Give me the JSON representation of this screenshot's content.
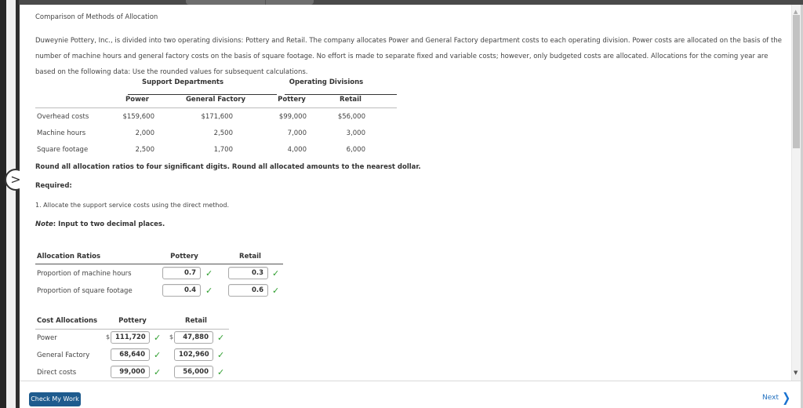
{
  "problem": {
    "title": "Comparison of Methods of Allocation",
    "paragraph": "Duweynie Pottery, Inc., is divided into two operating divisions: Pottery and Retail. The company allocates Power and General Factory department costs to each operating division. Power costs are allocated on the basis of the number of machine hours and general factory costs on the basis of square footage. No effort is made to separate fixed and variable costs; however, only budgeted costs are allocated. Allocations for the coming year are based on the following data: Use the rounded values for subsequent calculations."
  },
  "data_table": {
    "group_headers": [
      "Support Departments",
      "Operating Divisions"
    ],
    "columns": [
      "Power",
      "General Factory",
      "Pottery",
      "Retail"
    ],
    "rows": [
      {
        "label": "Overhead costs",
        "values": [
          "$159,600",
          "$171,600",
          "$99,000",
          "$56,000"
        ]
      },
      {
        "label": "Machine hours",
        "values": [
          "2,000",
          "2,500",
          "7,000",
          "3,000"
        ]
      },
      {
        "label": "Square footage",
        "values": [
          "2,500",
          "1,700",
          "4,000",
          "6,000"
        ]
      }
    ]
  },
  "instructions": {
    "rounding_note": "Round all allocation ratios to four significant digits. Round all allocated amounts to the nearest dollar.",
    "required_label": "Required:",
    "task": "1. Allocate the support service costs using the direct method.",
    "note_prefix": "Note",
    "note_text": ": Input to two decimal places."
  },
  "ratios_table": {
    "header": "Allocation Ratios",
    "columns": [
      "Pottery",
      "Retail"
    ],
    "rows": [
      {
        "label": "Proportion of machine hours",
        "values": [
          "0.7",
          "0.3"
        ],
        "status": [
          "correct",
          "correct"
        ]
      },
      {
        "label": "Proportion of square footage",
        "values": [
          "0.4",
          "0.6"
        ],
        "status": [
          "correct",
          "correct"
        ]
      }
    ]
  },
  "cost_table": {
    "header": "Cost Allocations",
    "columns": [
      "Pottery",
      "Retail"
    ],
    "currency_symbol": "$",
    "rows": [
      {
        "label": "Power",
        "values": [
          "111,720",
          "47,880"
        ],
        "status": [
          "correct",
          "correct"
        ]
      },
      {
        "label": "General Factory",
        "values": [
          "68,640",
          "102,960"
        ],
        "status": [
          "correct",
          "correct"
        ]
      },
      {
        "label": "Direct costs",
        "values": [
          "99,000",
          "56,000"
        ],
        "status": [
          "correct",
          "correct"
        ]
      }
    ]
  },
  "icons": {
    "check": "✓",
    "expand": ">",
    "next_chevron": "❯",
    "scroll_up": "▲",
    "scroll_down": "▼"
  },
  "footer": {
    "check_button": "Check My Work",
    "next_button": "Next"
  },
  "colors": {
    "check_green": "#2e9e2e",
    "button_blue": "#1e5b8e",
    "link_blue": "#1f6fbf"
  }
}
